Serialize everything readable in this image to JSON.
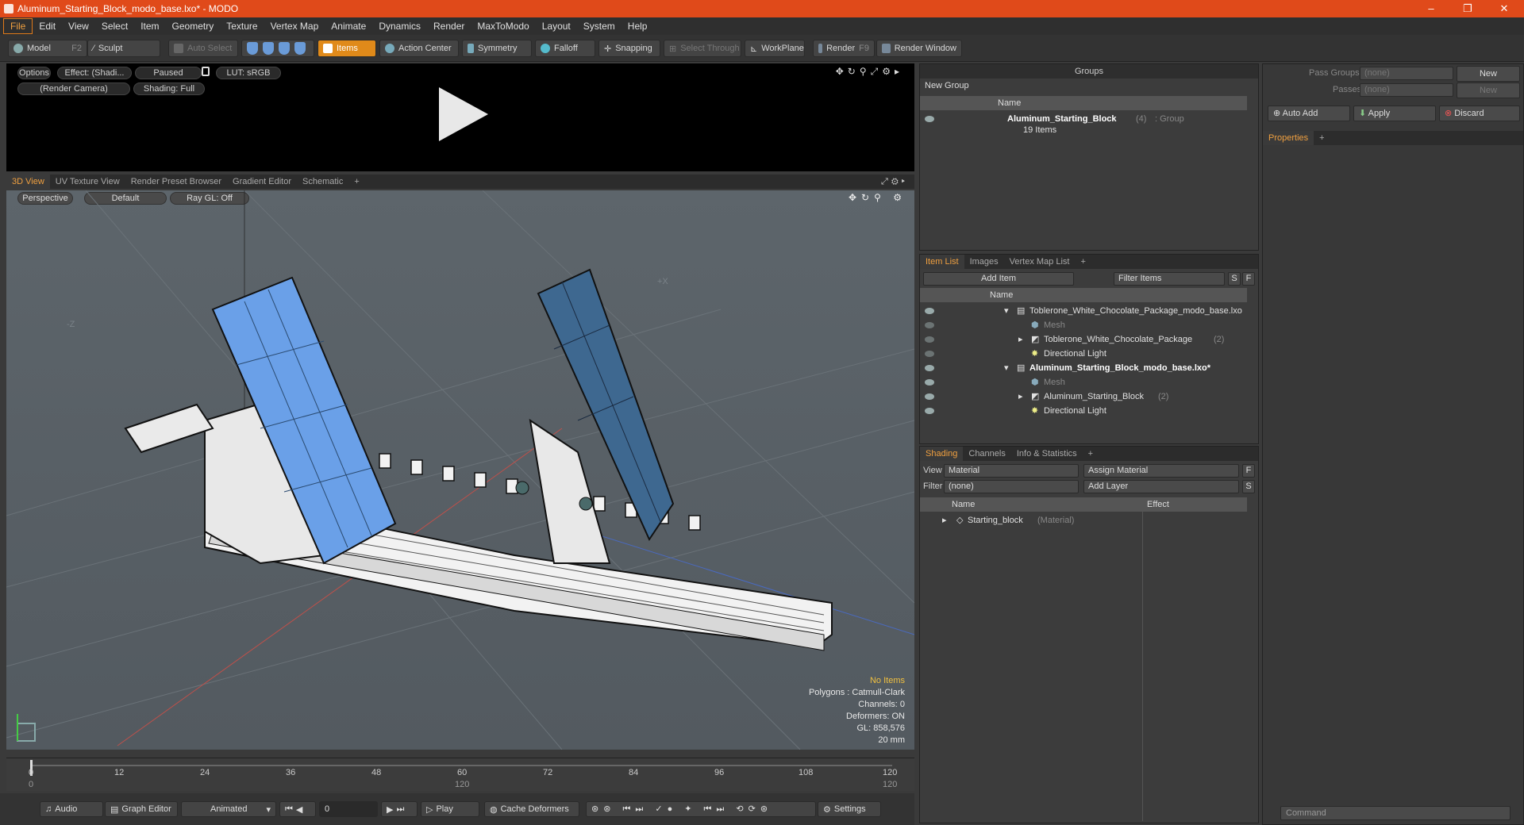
{
  "window": {
    "title": "Aluminum_Starting_Block_modo_base.lxo* - MODO",
    "minimize": "–",
    "maximize": "❐",
    "close": "✕"
  },
  "menu": [
    "File",
    "Edit",
    "View",
    "Select",
    "Item",
    "Geometry",
    "Texture",
    "Vertex Map",
    "Animate",
    "Dynamics",
    "Render",
    "MaxToModo",
    "Layout",
    "System",
    "Help"
  ],
  "toolbar": {
    "model": "Model",
    "model_key": "F2",
    "sculpt": "Sculpt",
    "auto_select": "Auto Select",
    "items": "Items",
    "action_center": "Action Center",
    "symmetry": "Symmetry",
    "falloff": "Falloff",
    "snapping": "Snapping",
    "select_through": "Select Through",
    "workplane": "WorkPlane",
    "render": "Render",
    "render_key": "F9",
    "render_window": "Render Window"
  },
  "preview": {
    "options": "Options",
    "effect": "Effect: (Shadi...",
    "paused": "Paused",
    "lut": "LUT: sRGB",
    "camera": "(Render Camera)",
    "shading": "Shading: Full"
  },
  "view_tabs": [
    "3D View",
    "UV Texture View",
    "Render Preset Browser",
    "Gradient Editor",
    "Schematic",
    "+"
  ],
  "view3d": {
    "perspective": "Perspective",
    "default": "Default",
    "raygl": "Ray GL: Off",
    "axis_x": "+X",
    "axis_z": "-Z"
  },
  "stats": {
    "no_items": "No Items",
    "polygons": "Polygons : Catmull-Clark",
    "channels": "Channels: 0",
    "deformers": "Deformers: ON",
    "gl": "GL: 858,576",
    "scale": "20 mm"
  },
  "timeline": {
    "ticks": [
      "0",
      "12",
      "24",
      "36",
      "48",
      "60",
      "72",
      "84",
      "96",
      "108",
      "120"
    ],
    "sub_start": "0",
    "sub_mid": "120",
    "sub_end": "120"
  },
  "bottom": {
    "audio": "Audio",
    "graph_editor": "Graph Editor",
    "animated": "Animated",
    "frame": "0",
    "play": "Play",
    "cache": "Cache Deformers",
    "settings": "Settings"
  },
  "groups": {
    "title": "Groups",
    "new_group": "New Group",
    "col_name": "Name",
    "group_name": "Aluminum_Starting_Block",
    "group_count": "(4)",
    "group_type": ": Group",
    "group_items": "19 Items"
  },
  "right": {
    "pass_groups": "Pass Groups",
    "passes": "Passes",
    "none": "(none)",
    "new": "New",
    "auto_add": "Auto Add",
    "apply": "Apply",
    "discard": "Discard",
    "properties": "Properties",
    "plus": "+"
  },
  "itemlist": {
    "tabs": [
      "Item List",
      "Images",
      "Vertex Map List",
      "+"
    ],
    "add_item": "Add Item",
    "filter_items": "Filter Items",
    "s": "S",
    "f": "F",
    "col_name": "Name",
    "rows": [
      {
        "label": "Toblerone_White_Chocolate_Package_modo_base.lxo",
        "extra": ""
      },
      {
        "label": "Mesh",
        "extra": ""
      },
      {
        "label": "Toblerone_White_Chocolate_Package",
        "extra": "(2)"
      },
      {
        "label": "Directional Light",
        "extra": ""
      },
      {
        "label": "Aluminum_Starting_Block_modo_base.lxo*",
        "extra": ""
      },
      {
        "label": "Mesh",
        "extra": ""
      },
      {
        "label": "Aluminum_Starting_Block",
        "extra": "(2)"
      },
      {
        "label": "Directional Light",
        "extra": ""
      }
    ]
  },
  "shading": {
    "tabs": [
      "Shading",
      "Channels",
      "Info & Statistics",
      "+"
    ],
    "view_label": "View",
    "view_value": "Material",
    "assign": "Assign Material",
    "f": "F",
    "filter_label": "Filter",
    "filter_value": "(none)",
    "add_layer": "Add Layer",
    "s": "S",
    "col_name": "Name",
    "col_effect": "Effect",
    "material": "Starting_block",
    "material_type": "(Material)"
  },
  "command": {
    "placeholder": "Command"
  }
}
